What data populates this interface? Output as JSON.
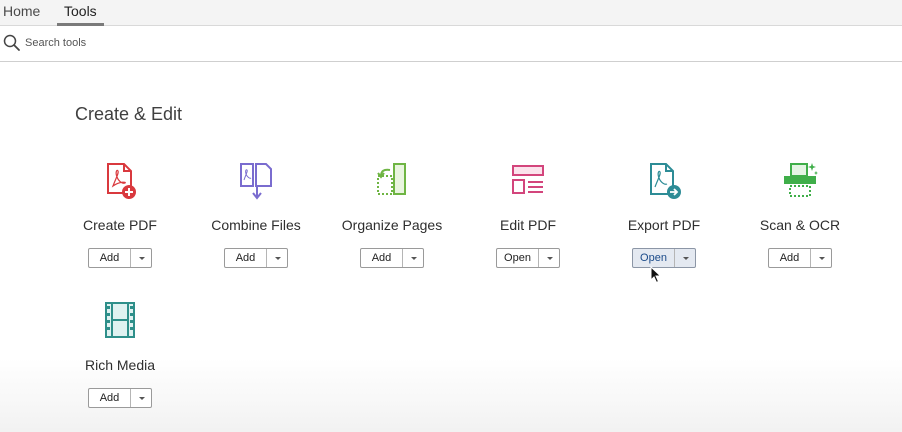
{
  "nav": {
    "tabs": [
      {
        "label": "Home"
      },
      {
        "label": "Tools"
      }
    ]
  },
  "search": {
    "placeholder": "Search tools",
    "icon": "search-icon"
  },
  "section": {
    "title": "Create & Edit"
  },
  "tools": [
    {
      "label": "Create PDF",
      "button": "Add",
      "icon": "create-pdf-icon",
      "color": "#d9393e"
    },
    {
      "label": "Combine Files",
      "button": "Add",
      "icon": "combine-files-icon",
      "color": "#7a6ccf"
    },
    {
      "label": "Organize Pages",
      "button": "Add",
      "icon": "organize-pages-icon",
      "color": "#6fb544"
    },
    {
      "label": "Edit PDF",
      "button": "Open",
      "icon": "edit-pdf-icon",
      "color": "#d3457c"
    },
    {
      "label": "Export PDF",
      "button": "Open",
      "icon": "export-pdf-icon",
      "color": "#2d8c96"
    },
    {
      "label": "Scan & OCR",
      "button": "Add",
      "icon": "scan-ocr-icon",
      "color": "#3fae49"
    },
    {
      "label": "Rich Media",
      "button": "Add",
      "icon": "rich-media-icon",
      "color": "#2e8f8a"
    }
  ]
}
